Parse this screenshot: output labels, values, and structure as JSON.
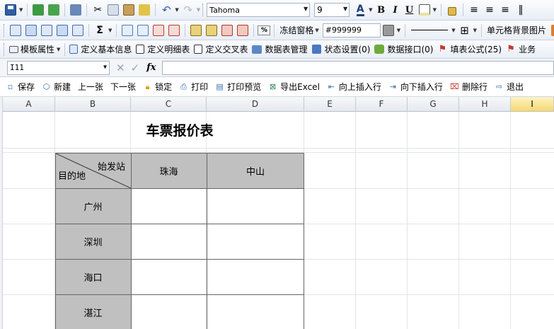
{
  "toolbar1": {
    "font_name": "Tahoma",
    "font_size": "9",
    "bold": "B",
    "italic": "I",
    "underline": "U"
  },
  "toolbar2": {
    "sigma": "Σ",
    "freeze": "冻结窗格",
    "color_value": "#999999",
    "cell_bg_image": "单元格背景图片"
  },
  "toolbar3": {
    "items": [
      {
        "label": "模板属性"
      },
      {
        "label": "定义基本信息"
      },
      {
        "label": "定义明细表"
      },
      {
        "label": "定义交叉表"
      },
      {
        "label": "数据表管理"
      },
      {
        "label": "状态设置(0)"
      },
      {
        "label": "数据接口(0)"
      },
      {
        "label": "填表公式(25)"
      },
      {
        "label": "业务"
      }
    ]
  },
  "formula_bar": {
    "cell_ref": "I11",
    "fx_label": "fx",
    "value": ""
  },
  "action_bar": {
    "items": [
      {
        "label": "保存"
      },
      {
        "label": "新建"
      },
      {
        "label": "上一张"
      },
      {
        "label": "下一张"
      },
      {
        "label": "锁定"
      },
      {
        "label": "打印"
      },
      {
        "label": "打印预览"
      },
      {
        "label": "导出Excel"
      },
      {
        "label": "向上插入行"
      },
      {
        "label": "向下插入行"
      },
      {
        "label": "删除行"
      },
      {
        "label": "退出"
      }
    ]
  },
  "sheet": {
    "columns": [
      "A",
      "B",
      "C",
      "D",
      "E",
      "F",
      "G",
      "H",
      "I"
    ],
    "selected_column": "I",
    "title": "车票报价表",
    "corner_top": "始发站",
    "corner_bottom": "目的地",
    "col_headers": [
      "珠海",
      "中山"
    ],
    "row_headers": [
      "广州",
      "深圳",
      "海口",
      "湛江"
    ]
  },
  "colors": {
    "header_fill": "#c0c0c0",
    "selected_col": "#f7d96f",
    "accent_blue": "#3a6fb0"
  }
}
